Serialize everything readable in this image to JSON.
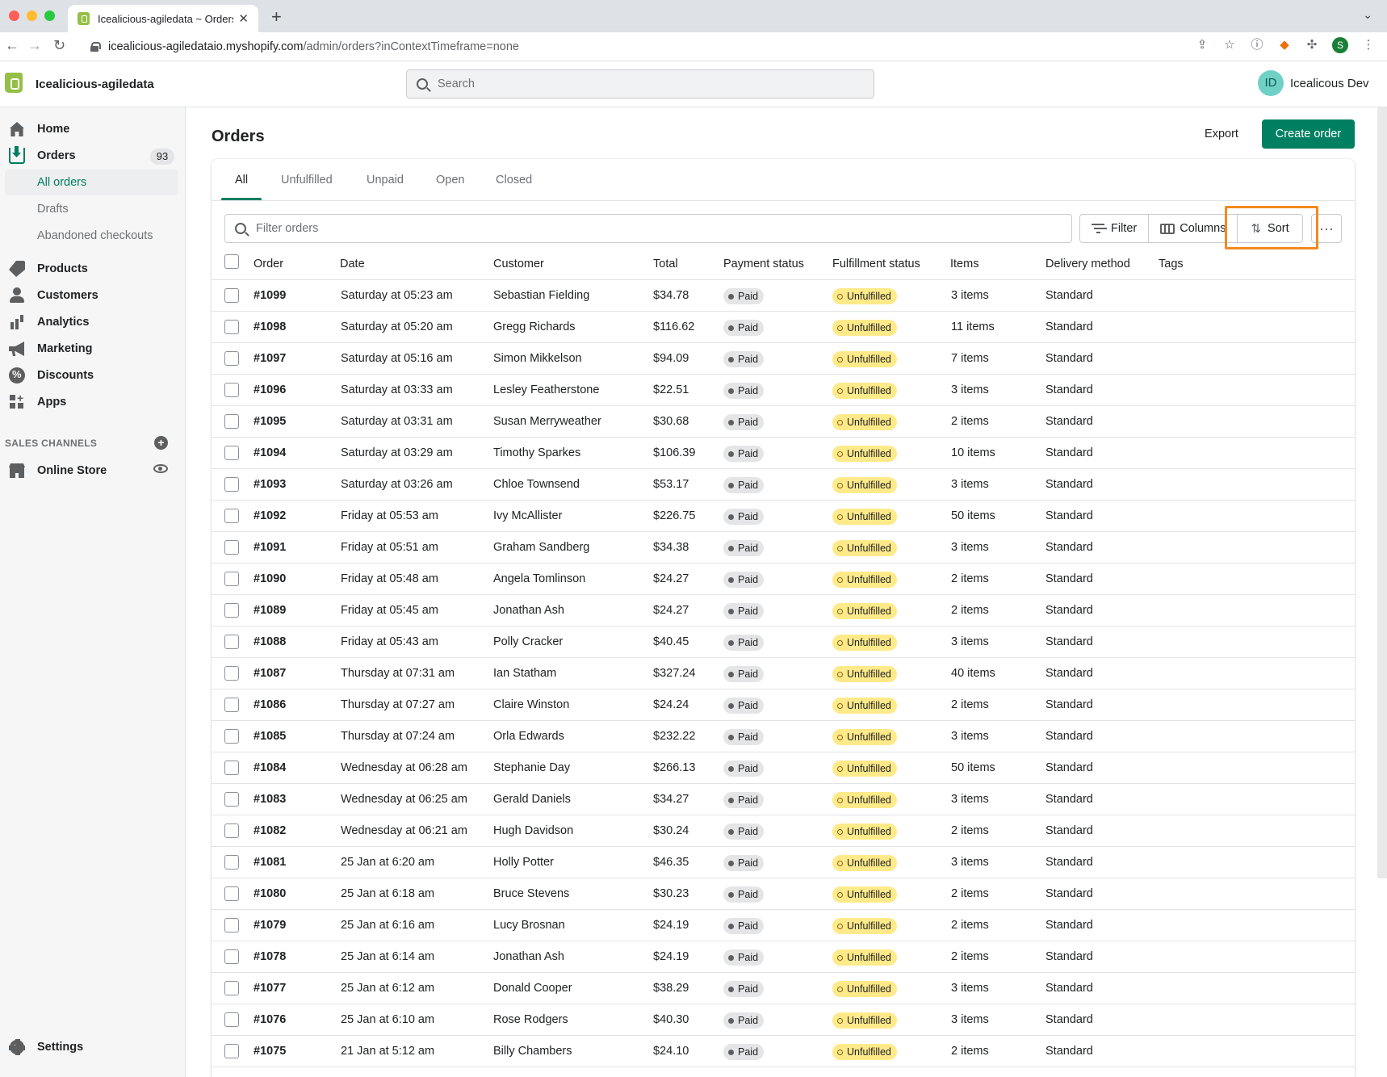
{
  "browser": {
    "tab_title": "Icealicious-agiledata ~ Orders",
    "url_host": "icealicious-agiledataio.myshopify.com",
    "url_path": "/admin/orders?inContextTimeframe=none",
    "profile_initial": "S"
  },
  "topbar": {
    "store_name": "Icealicious-agiledata",
    "search_placeholder": "Search",
    "user_initials": "ID",
    "user_name": "Icealicous Dev"
  },
  "sidebar": {
    "home": "Home",
    "orders": "Orders",
    "orders_count": "93",
    "all_orders": "All orders",
    "drafts": "Drafts",
    "abandoned": "Abandoned checkouts",
    "products": "Products",
    "customers": "Customers",
    "analytics": "Analytics",
    "marketing": "Marketing",
    "discounts": "Discounts",
    "apps": "Apps",
    "sales_channels": "SALES CHANNELS",
    "online_store": "Online Store",
    "settings": "Settings"
  },
  "page": {
    "title": "Orders",
    "export": "Export",
    "create_order": "Create order"
  },
  "tabs": [
    "All",
    "Unfulfilled",
    "Unpaid",
    "Open",
    "Closed"
  ],
  "toolbar": {
    "filter_placeholder": "Filter orders",
    "filter": "Filter",
    "columns": "Columns",
    "sort": "Sort",
    "more": "···"
  },
  "columns": {
    "order": "Order",
    "date": "Date",
    "customer": "Customer",
    "total": "Total",
    "payment": "Payment status",
    "fulfillment": "Fulfillment status",
    "items": "Items",
    "delivery": "Delivery method",
    "tags": "Tags"
  },
  "orders": [
    {
      "order": "#1099",
      "date": "Saturday at 05:23 am",
      "customer": "Sebastian Fielding",
      "total": "$34.78",
      "payment": "Paid",
      "fulfillment": "Unfulfilled",
      "items": "3 items",
      "delivery": "Standard"
    },
    {
      "order": "#1098",
      "date": "Saturday at 05:20 am",
      "customer": "Gregg Richards",
      "total": "$116.62",
      "payment": "Paid",
      "fulfillment": "Unfulfilled",
      "items": "11 items",
      "delivery": "Standard"
    },
    {
      "order": "#1097",
      "date": "Saturday at 05:16 am",
      "customer": "Simon Mikkelson",
      "total": "$94.09",
      "payment": "Paid",
      "fulfillment": "Unfulfilled",
      "items": "7 items",
      "delivery": "Standard"
    },
    {
      "order": "#1096",
      "date": "Saturday at 03:33 am",
      "customer": "Lesley Featherstone",
      "total": "$22.51",
      "payment": "Paid",
      "fulfillment": "Unfulfilled",
      "items": "3 items",
      "delivery": "Standard"
    },
    {
      "order": "#1095",
      "date": "Saturday at 03:31 am",
      "customer": "Susan Merryweather",
      "total": "$30.68",
      "payment": "Paid",
      "fulfillment": "Unfulfilled",
      "items": "2 items",
      "delivery": "Standard"
    },
    {
      "order": "#1094",
      "date": "Saturday at 03:29 am",
      "customer": "Timothy Sparkes",
      "total": "$106.39",
      "payment": "Paid",
      "fulfillment": "Unfulfilled",
      "items": "10 items",
      "delivery": "Standard"
    },
    {
      "order": "#1093",
      "date": "Saturday at 03:26 am",
      "customer": "Chloe Townsend",
      "total": "$53.17",
      "payment": "Paid",
      "fulfillment": "Unfulfilled",
      "items": "3 items",
      "delivery": "Standard"
    },
    {
      "order": "#1092",
      "date": "Friday at 05:53 am",
      "customer": "Ivy McAllister",
      "total": "$226.75",
      "payment": "Paid",
      "fulfillment": "Unfulfilled",
      "items": "50 items",
      "delivery": "Standard"
    },
    {
      "order": "#1091",
      "date": "Friday at 05:51 am",
      "customer": "Graham Sandberg",
      "total": "$34.38",
      "payment": "Paid",
      "fulfillment": "Unfulfilled",
      "items": "3 items",
      "delivery": "Standard"
    },
    {
      "order": "#1090",
      "date": "Friday at 05:48 am",
      "customer": "Angela Tomlinson",
      "total": "$24.27",
      "payment": "Paid",
      "fulfillment": "Unfulfilled",
      "items": "2 items",
      "delivery": "Standard"
    },
    {
      "order": "#1089",
      "date": "Friday at 05:45 am",
      "customer": "Jonathan Ash",
      "total": "$24.27",
      "payment": "Paid",
      "fulfillment": "Unfulfilled",
      "items": "2 items",
      "delivery": "Standard"
    },
    {
      "order": "#1088",
      "date": "Friday at 05:43 am",
      "customer": "Polly Cracker",
      "total": "$40.45",
      "payment": "Paid",
      "fulfillment": "Unfulfilled",
      "items": "3 items",
      "delivery": "Standard"
    },
    {
      "order": "#1087",
      "date": "Thursday at 07:31 am",
      "customer": "Ian Statham",
      "total": "$327.24",
      "payment": "Paid",
      "fulfillment": "Unfulfilled",
      "items": "40 items",
      "delivery": "Standard"
    },
    {
      "order": "#1086",
      "date": "Thursday at 07:27 am",
      "customer": "Claire Winston",
      "total": "$24.24",
      "payment": "Paid",
      "fulfillment": "Unfulfilled",
      "items": "2 items",
      "delivery": "Standard"
    },
    {
      "order": "#1085",
      "date": "Thursday at 07:24 am",
      "customer": "Orla Edwards",
      "total": "$232.22",
      "payment": "Paid",
      "fulfillment": "Unfulfilled",
      "items": "3 items",
      "delivery": "Standard"
    },
    {
      "order": "#1084",
      "date": "Wednesday at 06:28 am",
      "customer": "Stephanie Day",
      "total": "$266.13",
      "payment": "Paid",
      "fulfillment": "Unfulfilled",
      "items": "50 items",
      "delivery": "Standard"
    },
    {
      "order": "#1083",
      "date": "Wednesday at 06:25 am",
      "customer": "Gerald Daniels",
      "total": "$34.27",
      "payment": "Paid",
      "fulfillment": "Unfulfilled",
      "items": "3 items",
      "delivery": "Standard"
    },
    {
      "order": "#1082",
      "date": "Wednesday at 06:21 am",
      "customer": "Hugh Davidson",
      "total": "$30.24",
      "payment": "Paid",
      "fulfillment": "Unfulfilled",
      "items": "2 items",
      "delivery": "Standard"
    },
    {
      "order": "#1081",
      "date": "25 Jan at 6:20 am",
      "customer": "Holly Potter",
      "total": "$46.35",
      "payment": "Paid",
      "fulfillment": "Unfulfilled",
      "items": "3 items",
      "delivery": "Standard"
    },
    {
      "order": "#1080",
      "date": "25 Jan at 6:18 am",
      "customer": "Bruce Stevens",
      "total": "$30.23",
      "payment": "Paid",
      "fulfillment": "Unfulfilled",
      "items": "2 items",
      "delivery": "Standard"
    },
    {
      "order": "#1079",
      "date": "25 Jan at 6:16 am",
      "customer": "Lucy Brosnan",
      "total": "$24.19",
      "payment": "Paid",
      "fulfillment": "Unfulfilled",
      "items": "2 items",
      "delivery": "Standard"
    },
    {
      "order": "#1078",
      "date": "25 Jan at 6:14 am",
      "customer": "Jonathan Ash",
      "total": "$24.19",
      "payment": "Paid",
      "fulfillment": "Unfulfilled",
      "items": "2 items",
      "delivery": "Standard"
    },
    {
      "order": "#1077",
      "date": "25 Jan at 6:12 am",
      "customer": "Donald Cooper",
      "total": "$38.29",
      "payment": "Paid",
      "fulfillment": "Unfulfilled",
      "items": "3 items",
      "delivery": "Standard"
    },
    {
      "order": "#1076",
      "date": "25 Jan at 6:10 am",
      "customer": "Rose Rodgers",
      "total": "$40.30",
      "payment": "Paid",
      "fulfillment": "Unfulfilled",
      "items": "3 items",
      "delivery": "Standard"
    },
    {
      "order": "#1075",
      "date": "21 Jan at 5:12 am",
      "customer": "Billy Chambers",
      "total": "$24.10",
      "payment": "Paid",
      "fulfillment": "Unfulfilled",
      "items": "2 items",
      "delivery": "Standard"
    }
  ],
  "colors": {
    "accent": "#008060",
    "highlight": "#f28a1d",
    "unfulfilled_badge": "#ffea8a"
  }
}
